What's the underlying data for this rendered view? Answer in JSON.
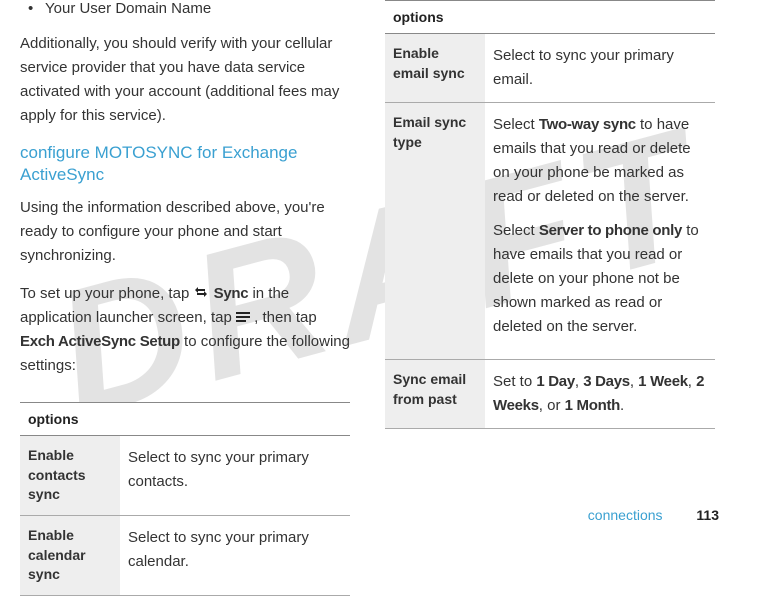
{
  "watermark": "DRAFT",
  "left": {
    "bullet1": "Your User Domain Name",
    "para1": "Additionally, you should verify with your cellular service provider that you have data service activated with your account (additional fees may apply for this service).",
    "heading": "configure MOTOSYNC for Exchange ActiveSync",
    "para2": "Using the information described above, you're ready to configure your phone and start synchronizing.",
    "setup_pre": "To set up your phone, tap ",
    "sync_label": "Sync",
    "setup_mid1": " in the application launcher screen, tap ",
    "setup_mid2": ", then tap ",
    "exch_label": "Exch ActiveSync Setup",
    "setup_end": " to configure the following settings:",
    "table_header": "options",
    "row1_l": "Enable contacts sync",
    "row1_r": "Select to sync your primary contacts.",
    "row2_l": "Enable calendar sync",
    "row2_r": "Select to sync your primary calendar."
  },
  "right": {
    "table_header": "options",
    "row1_l": "Enable email sync",
    "row1_r": "Select to sync your primary email.",
    "row2_l": "Email sync type",
    "row2_r_a": "Select ",
    "row2_r_b": "Two-way sync",
    "row2_r_c": " to have emails that you read or delete on your phone be marked as read or deleted on the server.",
    "row2_r_d": "Select ",
    "row2_r_e": "Server to phone only",
    "row2_r_f": " to have emails that you read or delete on your phone not be shown marked as read or deleted on the server.",
    "row3_l": "Sync email from past",
    "row3_r_a": "Set to ",
    "row3_r_b": "1 Day",
    "row3_r_c": ", ",
    "row3_r_d": "3 Days",
    "row3_r_e": ", ",
    "row3_r_f": "1 Week",
    "row3_r_g": ", ",
    "row3_r_h": "2 Weeks",
    "row3_r_i": ", or ",
    "row3_r_j": "1 Month",
    "row3_r_k": "."
  },
  "footer": {
    "section": "connections",
    "page": "113"
  }
}
